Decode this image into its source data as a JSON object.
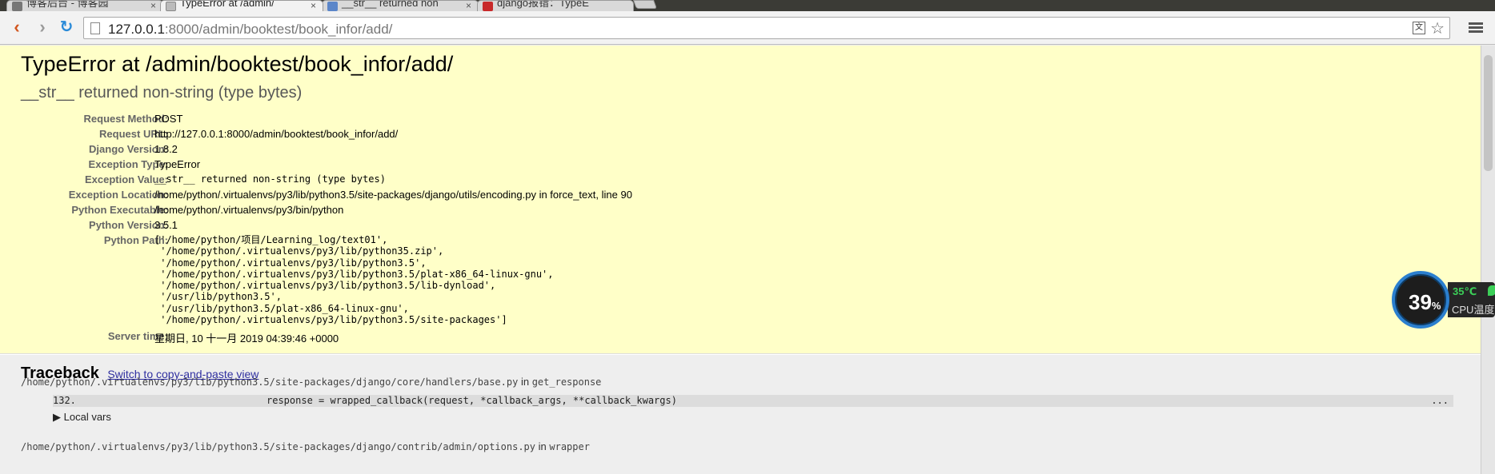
{
  "browser": {
    "tabs": [
      {
        "label": "博客后台 - 博客园",
        "active": false
      },
      {
        "label": "TypeError at /admin/",
        "active": true
      },
      {
        "label": "__str__ returned non",
        "active": false
      },
      {
        "label": "django报错：TypeE",
        "active": false
      }
    ],
    "url_host": "127.0.0.1",
    "url_rest": ":8000/admin/booktest/book_infor/add/",
    "tab_close_glyph": "×"
  },
  "error": {
    "title": "TypeError at /admin/booktest/book_infor/add/",
    "subtitle": "__str__ returned non-string (type bytes)"
  },
  "meta": [
    {
      "key": "Request Method:",
      "value": "POST"
    },
    {
      "key": "Request URL:",
      "value": "http://127.0.0.1:8000/admin/booktest/book_infor/add/"
    },
    {
      "key": "Django Version:",
      "value": "1.8.2"
    },
    {
      "key": "Exception Type:",
      "value": "TypeError"
    },
    {
      "key": "Exception Value:",
      "value": "__str__ returned non-string (type bytes)"
    },
    {
      "key": "Exception Location:",
      "value": "/home/python/.virtualenvs/py3/lib/python3.5/site-packages/django/utils/encoding.py in force_text, line 90"
    },
    {
      "key": "Python Executable:",
      "value": "/home/python/.virtualenvs/py3/bin/python"
    },
    {
      "key": "Python Version:",
      "value": "3.5.1"
    },
    {
      "key": "Python Path:",
      "value": "['/home/python/项目/Learning_log/text01',\n '/home/python/.virtualenvs/py3/lib/python35.zip',\n '/home/python/.virtualenvs/py3/lib/python3.5',\n '/home/python/.virtualenvs/py3/lib/python3.5/plat-x86_64-linux-gnu',\n '/home/python/.virtualenvs/py3/lib/python3.5/lib-dynload',\n '/usr/lib/python3.5',\n '/usr/lib/python3.5/plat-x86_64-linux-gnu',\n '/home/python/.virtualenvs/py3/lib/python3.5/site-packages']"
    },
    {
      "key": "Server time:",
      "value": "星期日, 10 十一月 2019 04:39:46 +0000"
    }
  ],
  "traceback": {
    "title": "Traceback",
    "switch_link": "Switch to copy-and-paste view",
    "frames": [
      {
        "file": "/home/python/.virtualenvs/py3/lib/python3.5/site-packages/django/core/handlers/base.py",
        "in_word": "in",
        "func": "get_response",
        "line_no": "132.",
        "code": "response = wrapped_callback(request, *callback_args, **callback_kwargs)",
        "ellipsis": "...",
        "local_vars": "Local vars"
      },
      {
        "file": "/home/python/.virtualenvs/py3/lib/python3.5/site-packages/django/contrib/admin/options.py",
        "in_word": "in",
        "func": "wrapper"
      }
    ]
  },
  "cpu_widget": {
    "percent": "39",
    "percent_sign": "%",
    "temperature": "35℃",
    "label": "CPU温度"
  },
  "colors": {
    "summary_bg": "#ffffc8",
    "traceback_bg": "#eeeeee",
    "link": "#3030a0",
    "reload_blue": "#2a8ad8",
    "back_orange": "#d2561f"
  }
}
